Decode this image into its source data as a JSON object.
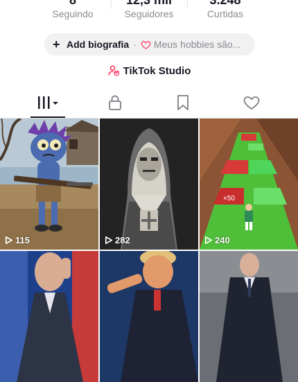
{
  "stats": [
    {
      "value": "8",
      "label": "Seguindo"
    },
    {
      "value": "12,3 mil",
      "label": "Seguidores"
    },
    {
      "value": "3.248",
      "label": "Curtidas"
    }
  ],
  "bio": {
    "add_label": "Add biografia",
    "separator": "·",
    "hobbies_text": "Meus hobbies são..."
  },
  "studio": {
    "label": "TikTok Studio"
  },
  "tabs": [
    {
      "name": "videos",
      "icon": "grid-lines-icon",
      "active": true
    },
    {
      "name": "private",
      "icon": "lock-icon",
      "active": false
    },
    {
      "name": "favorites",
      "icon": "bookmark-icon",
      "active": false
    },
    {
      "name": "liked",
      "icon": "heart-icon",
      "active": false
    }
  ],
  "videos": [
    {
      "views": "115",
      "thumb": "blue cartoon character with rifle"
    },
    {
      "views": "282",
      "thumb": "hooded figure in dark"
    },
    {
      "views": "240",
      "thumb": "runner game with gates"
    },
    {
      "views": "",
      "thumb": "man in suit touching head"
    },
    {
      "views": "",
      "thumb": "man pointing"
    },
    {
      "views": "",
      "thumb": "man at podium"
    }
  ],
  "colors": {
    "text": "#161823",
    "muted": "#8a8b91",
    "accent": "#fe2c55",
    "pill": "#f1f1f2"
  }
}
